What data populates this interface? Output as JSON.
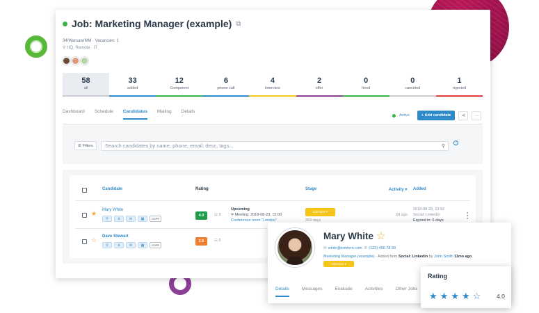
{
  "job": {
    "title": "Job: Marketing Manager (example)",
    "meta_line1": "34/Warsaw/MM  ·  Vacancies: 1",
    "meta_line2": "⚲  HQ, Remote  ·  IT"
  },
  "stats": [
    {
      "num": "58",
      "label": "all",
      "color": "#c9ced4"
    },
    {
      "num": "33",
      "label": "added",
      "color": "#2f8ac9"
    },
    {
      "num": "12",
      "label": "Competent",
      "color": "#3bb54a"
    },
    {
      "num": "6",
      "label": "phone call",
      "color": "#2f8ac9"
    },
    {
      "num": "4",
      "label": "interview",
      "color": "#f5c518"
    },
    {
      "num": "2",
      "label": "offer",
      "color": "#8a3f95"
    },
    {
      "num": "0",
      "label": "hired",
      "color": "#3bb54a"
    },
    {
      "num": "0",
      "label": "canceled",
      "color": "#c9ced4"
    },
    {
      "num": "1",
      "label": "rejected",
      "color": "#e53935"
    }
  ],
  "tabs": [
    "Dashboard",
    "Schedule",
    "Candidates",
    "Mailing",
    "Details"
  ],
  "actions": {
    "active_label": "Active",
    "add_candidate": "+ Add candidate",
    "share_icon": "share-icon",
    "more_icon": "more-icon"
  },
  "filter": {
    "filters_label": "Filters",
    "search_placeholder": "Search candidates by name, phone, email, desc, tags..."
  },
  "table": {
    "headers": {
      "candidate": "Candidate",
      "rating": "Rating",
      "stage": "Stage",
      "activity": "Activity ▾",
      "added": "Added"
    },
    "rows": [
      {
        "name": "Mary White",
        "starred": true,
        "rating": "4.0",
        "rating_color": "#1e9e4a",
        "notes": "3",
        "upcoming_title": "Upcoming",
        "upcoming_meeting": "Meeting: 2019-08-23, 15:00",
        "upcoming_room": "Conference room \"London\"",
        "stage": "Interview ▾",
        "stage_days": "359 days",
        "activity": "2d ago",
        "added_date": "2018-08-28, 13:52",
        "added_source": "Social: Linkedin",
        "added_expiry": "Expired in: 6 days",
        "gdpr": "GDPR"
      },
      {
        "name": "Dave Stewart",
        "starred": false,
        "rating": "2.5",
        "rating_color": "#ef7f2e",
        "notes": "0",
        "gdpr": "GDPR"
      }
    ]
  },
  "profile": {
    "name": "Mary White",
    "email": "white@tomhrm.com",
    "phone": "(123) 456 78 99",
    "job_link": "Marketing Manager (example)",
    "added_from_prefix": " · Added from ",
    "added_source": "Social: Linkedin",
    "added_by_prefix": " by ",
    "added_by": "John Smith",
    "added_when": " 11mo ago",
    "stage": "Interview ▾",
    "tabs": [
      "Details",
      "Messages",
      "Evaluate",
      "Activities",
      "Other Jobs"
    ]
  },
  "rating_popup": {
    "title": "Rating",
    "value": "4.0",
    "stars_filled": 4,
    "stars_total": 5
  }
}
